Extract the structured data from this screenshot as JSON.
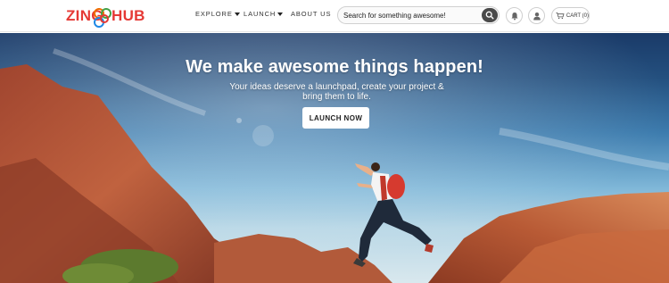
{
  "brand": {
    "name_left": "ZING",
    "name_right": "HUB",
    "logo_color": "#e53935",
    "ring_colors": [
      "#ef6c00",
      "#1e88e5",
      "#e53935",
      "#43a047"
    ]
  },
  "nav": {
    "items": [
      {
        "label": "EXPLORE",
        "has_dropdown": true
      },
      {
        "label": "LAUNCH",
        "has_dropdown": true
      },
      {
        "label": "ABOUT US",
        "has_dropdown": false
      }
    ]
  },
  "search": {
    "placeholder": "Search for something awesome!",
    "value": "",
    "icon": "search-icon"
  },
  "header_actions": {
    "notifications_icon": "bell-icon",
    "account_icon": "user-icon",
    "cart_icon": "cart-icon",
    "cart_label": "CART (0)"
  },
  "hero": {
    "title": "We make awesome things happen!",
    "subtitle": "Your ideas deserve a launchpad, create your project & bring them to life.",
    "cta_label": "LAUNCH NOW"
  }
}
